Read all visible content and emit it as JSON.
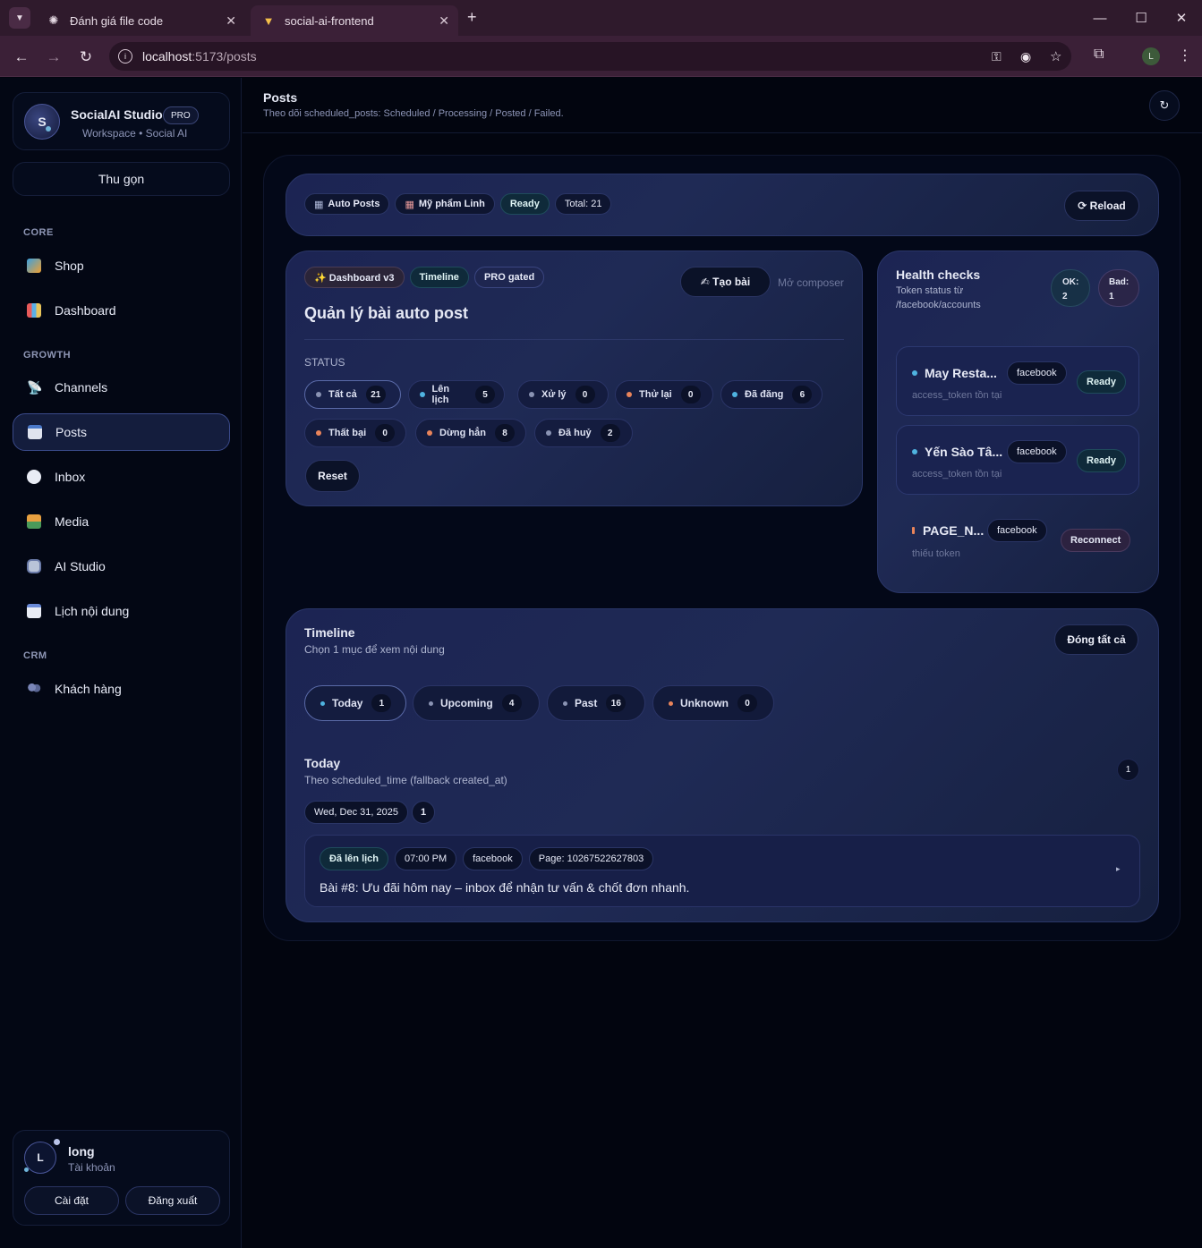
{
  "browser": {
    "tabs": [
      {
        "title": "Đánh giá file code"
      },
      {
        "title": "social-ai-frontend"
      }
    ],
    "url_host": "localhost",
    "url_path": ":5173/posts",
    "profile_initial": "L"
  },
  "sidebar": {
    "brand": {
      "initial": "S",
      "name": "SocialAI Studio",
      "badge": "PRO",
      "subtitle": "Workspace • Social AI"
    },
    "collapse_label": "Thu gọn",
    "sections": [
      {
        "title": "CORE",
        "items": [
          {
            "label": "Shop"
          },
          {
            "label": "Dashboard"
          }
        ]
      },
      {
        "title": "GROWTH",
        "items": [
          {
            "label": "Channels"
          },
          {
            "label": "Posts"
          },
          {
            "label": "Inbox"
          },
          {
            "label": "Media"
          },
          {
            "label": "AI Studio"
          },
          {
            "label": "Lịch nội dung"
          }
        ]
      },
      {
        "title": "CRM",
        "items": [
          {
            "label": "Khách hàng"
          }
        ]
      }
    ],
    "user": {
      "initial": "L",
      "name": "long",
      "subtitle": "Tài khoản",
      "settings_label": "Cài đặt",
      "logout_label": "Đăng xuất"
    }
  },
  "header": {
    "title": "Posts",
    "subtitle": "Theo dõi scheduled_posts: Scheduled / Processing / Posted / Failed."
  },
  "topbar": {
    "chips": [
      "Auto Posts",
      "Mỹ phẩm Linh",
      "Ready",
      "Total: 21"
    ],
    "reload_label": "⟳ Reload"
  },
  "manager": {
    "tags": [
      "✨ Dashboard v3",
      "Timeline",
      "PRO gated"
    ],
    "title": "Quản lý bài auto post",
    "create_label": "✍ Tạo bài",
    "composer_label": "Mở composer",
    "status_label": "STATUS",
    "filters": [
      {
        "label": "Tất cả",
        "count": "21"
      },
      {
        "label": "Lên lịch",
        "count": "5"
      },
      {
        "label": "Xử lý",
        "count": "0"
      },
      {
        "label": "Thử lại",
        "count": "0"
      },
      {
        "label": "Đã đăng",
        "count": "6"
      },
      {
        "label": "Thất bại",
        "count": "0"
      },
      {
        "label": "Dừng hẳn",
        "count": "8"
      },
      {
        "label": "Đã huỷ",
        "count": "2"
      }
    ],
    "reset_label": "Reset"
  },
  "health": {
    "title": "Health checks",
    "subtitle_1": "Token status từ",
    "subtitle_2": "/facebook/accounts",
    "ok_label": "OK:",
    "ok_value": "2",
    "bad_label": "Bad:",
    "bad_value": "1",
    "accounts": [
      {
        "name": "May Resta...",
        "platform": "facebook",
        "status": "Ready",
        "note": "access_token tồn tại"
      },
      {
        "name": "Yến Sào Tâ...",
        "platform": "facebook",
        "status": "Ready",
        "note": "access_token tồn tại"
      },
      {
        "name": "PAGE_N...",
        "platform": "facebook",
        "status": "Reconnect",
        "note": "thiếu token"
      }
    ]
  },
  "timeline": {
    "title": "Timeline",
    "subtitle": "Chọn 1 mục để xem nội dung",
    "close_all_label": "Đóng tất cả",
    "tabs": [
      {
        "label": "Today",
        "count": "1"
      },
      {
        "label": "Upcoming",
        "count": "4"
      },
      {
        "label": "Past",
        "count": "16"
      },
      {
        "label": "Unknown",
        "count": "0"
      }
    ],
    "group": {
      "title": "Today",
      "subtitle": "Theo scheduled_time (fallback created_at)",
      "count": "1",
      "date": "Wed, Dec 31, 2025",
      "date_count": "1"
    },
    "post": {
      "status": "Đã lên lịch",
      "time": "07:00 PM",
      "platform": "facebook",
      "page": "Page: 10267522627803",
      "text": "Bài #8: Ưu đãi hôm nay – inbox để nhận tư vấn & chốt đơn nhanh.",
      "expand_icon": "▸"
    }
  },
  "colors": {
    "dot_blue": "#4fb3e0",
    "dot_orange": "#e9845a",
    "dot_gray": "#8a93b3",
    "accent": "#5a6aa8"
  }
}
